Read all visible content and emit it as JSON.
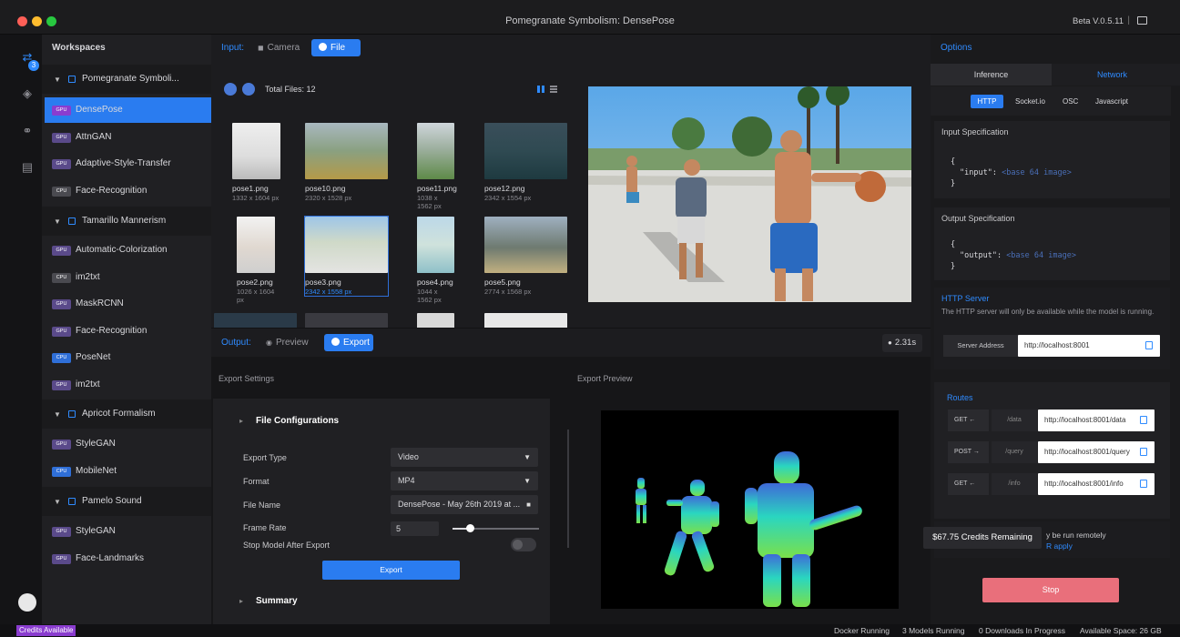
{
  "window": {
    "title": "Pomegranate Symbolism: DensePose",
    "version": "Beta V.0.5.11",
    "separator": "|"
  },
  "rail": {
    "badge": "3"
  },
  "sidebar": {
    "title": "Workspaces",
    "groups": [
      {
        "label": "Pomegranate Symboli...",
        "items": [
          {
            "badge": "GPU",
            "label": "DensePose",
            "selected": true
          },
          {
            "badge": "GPU",
            "label": "AttnGAN"
          },
          {
            "badge": "GPU",
            "label": "Adaptive-Style-Transfer"
          },
          {
            "badge": "CPU",
            "label": "Face-Recognition"
          }
        ]
      },
      {
        "label": "Tamarillo Mannerism",
        "items": [
          {
            "badge": "GPU",
            "label": "Automatic-Colorization"
          },
          {
            "badge": "CPU",
            "label": "im2txt"
          },
          {
            "badge": "GPU",
            "label": "MaskRCNN"
          },
          {
            "badge": "GPU",
            "label": "Face-Recognition"
          },
          {
            "badge": "CPU",
            "label": "PoseNet"
          },
          {
            "badge": "GPU",
            "label": "im2txt"
          }
        ]
      },
      {
        "label": "Apricot Formalism",
        "items": [
          {
            "badge": "GPU",
            "label": "StyleGAN"
          },
          {
            "badge": "CPU",
            "label": "MobileNet"
          }
        ]
      },
      {
        "label": "Pamelo Sound",
        "items": [
          {
            "badge": "GPU",
            "label": "StyleGAN"
          },
          {
            "badge": "GPU",
            "label": "Face-Landmarks"
          }
        ]
      }
    ]
  },
  "input": {
    "label": "Input:",
    "tab_camera": "Camera",
    "tab_file": "File"
  },
  "browser": {
    "total_files": "Total Files: 12",
    "files": [
      {
        "name": "pose1.png",
        "dims": "1332 x 1604 px"
      },
      {
        "name": "pose10.png",
        "dims": "2320 x 1528 px"
      },
      {
        "name": "pose11.png",
        "dims": "1038 x 1562 px"
      },
      {
        "name": "pose12.png",
        "dims": "2342 x 1554 px"
      },
      {
        "name": "pose2.png",
        "dims": "1026 x 1604 px"
      },
      {
        "name": "pose3.png",
        "dims": "2342 x 1558 px",
        "selected": true
      },
      {
        "name": "pose4.png",
        "dims": "1044 x 1562 px"
      },
      {
        "name": "pose5.png",
        "dims": "2774 x 1568 px"
      }
    ]
  },
  "output": {
    "label": "Output:",
    "tab_preview": "Preview",
    "tab_export": "Export",
    "timer": "2.31s"
  },
  "export": {
    "settings_caption": "Export Settings",
    "preview_caption": "Export Preview",
    "section_title": "File Configurations",
    "summary_title": "Summary",
    "rows": {
      "export_type_label": "Export Type",
      "export_type_value": "Video",
      "format_label": "Format",
      "format_value": "MP4",
      "file_name_label": "File Name",
      "file_name_value": "DensePose - May 26th 2019 at ...",
      "frame_rate_label": "Frame Rate",
      "frame_rate_value": "5",
      "stop_model_label": "Stop Model After Export"
    },
    "frame_rate_slider": 0.2,
    "export_button": "Export"
  },
  "options": {
    "title": "Options",
    "tab_inference": "Inference",
    "tab_network": "Network",
    "protocols": [
      "HTTP",
      "Socket.io",
      "OSC",
      "Javascript"
    ],
    "input_spec": {
      "title": "Input Specification",
      "open": "{",
      "key": "\"input\":",
      "value": "<base 64 image>",
      "close": "}"
    },
    "output_spec": {
      "title": "Output Specification",
      "open": "{",
      "key": "\"output\":",
      "value": "<base 64 image>",
      "close": "}"
    },
    "http_server": {
      "title": "HTTP Server",
      "desc": "The HTTP server will only be available while the model is running.",
      "addr_label": "Server Address",
      "addr_value": "http://localhost:8001"
    },
    "routes": {
      "title": "Routes",
      "items": [
        {
          "method": "GET",
          "arrow": "←",
          "path": "/data",
          "url": "http://localhost:8001/data"
        },
        {
          "method": "POST",
          "arrow": "→",
          "path": "/query",
          "url": "http://localhost:8001/query"
        },
        {
          "method": "GET",
          "arrow": "←",
          "path": "/info",
          "url": "http://localhost:8001/info"
        }
      ]
    },
    "tooltip": "$67.75 Credits Remaining",
    "remote_text": "y be run remotely",
    "remote_link": "R apply",
    "stop_button": "Stop"
  },
  "status": {
    "credits": "Credits Available",
    "docker": "Docker Running",
    "models": "3 Models Running",
    "downloads": "0 Downloads In Progress",
    "space": "Available Space: 26 GB"
  },
  "colors": {
    "accent": "#2a7cf0",
    "gpu_badge": "#8a3ccf",
    "stop": "#e96f7b"
  }
}
